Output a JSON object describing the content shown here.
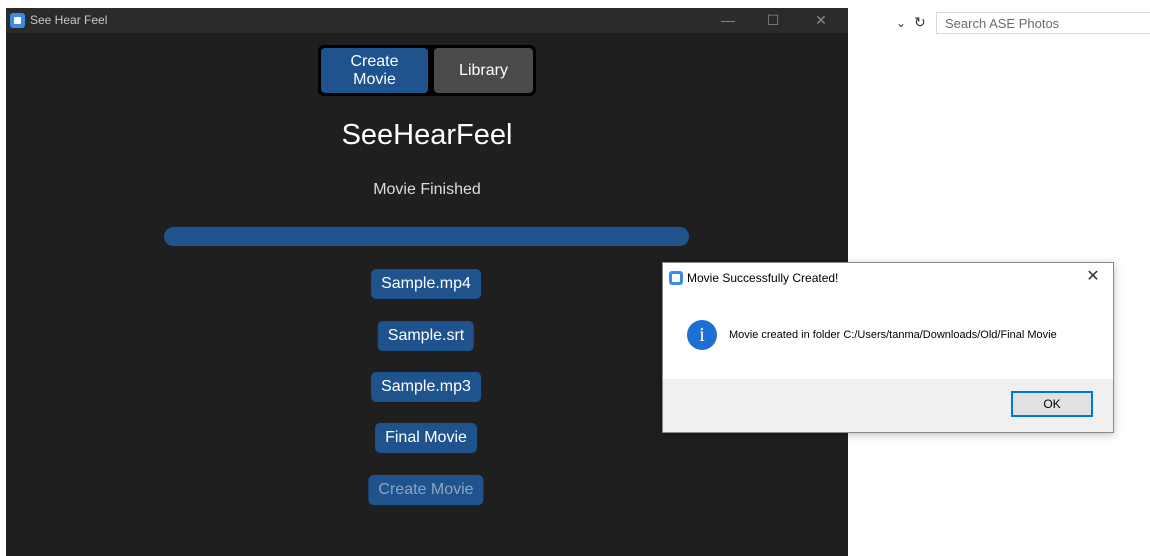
{
  "explorer": {
    "dropdown_glyph": "⌄",
    "refresh_glyph": "↻",
    "search_placeholder": "Search ASE Photos"
  },
  "window": {
    "title": "See Hear Feel",
    "minimize": "—",
    "maximize": "☐",
    "close": "✕"
  },
  "tabs": {
    "create": "Create Movie",
    "library": "Library"
  },
  "app_title": "SeeHearFeel",
  "status": "Movie Finished",
  "progress_percent": 100,
  "files": {
    "mp4": "Sample.mp4",
    "srt": "Sample.srt",
    "mp3": "Sample.mp3",
    "final": "Final Movie",
    "create": "Create Movie"
  },
  "dialog": {
    "title": "Movie Successfully Created!",
    "close": "✕",
    "icon_glyph": "i",
    "message": "Movie created in folder C:/Users/tanma/Downloads/Old/Final Movie",
    "ok": "OK"
  },
  "colors": {
    "accent": "#1f538d",
    "window_bg": "#1f1f1f",
    "info_blue": "#1d6fd1"
  }
}
